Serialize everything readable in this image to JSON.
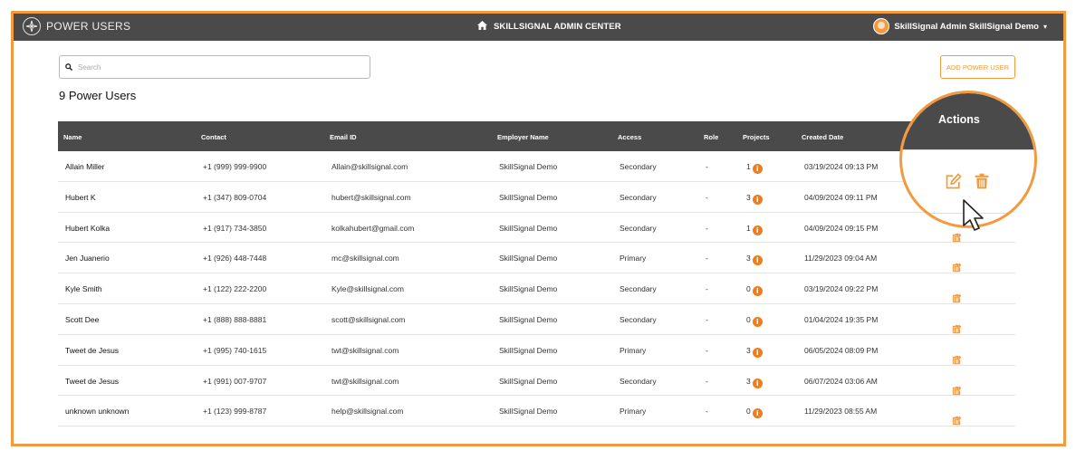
{
  "header": {
    "brand": "POWER USERS",
    "center_title": "SKILLSIGNAL ADMIN CENTER",
    "user_name": "SkillSignal Admin SkillSignal Demo"
  },
  "toolbar": {
    "search_placeholder": "Search",
    "add_button": "ADD POWER USER",
    "count_title": "9 Power Users"
  },
  "table": {
    "columns": {
      "name": "Name",
      "contact": "Contact",
      "email": "Email ID",
      "employer": "Employer Name",
      "access": "Access",
      "role": "Role",
      "projects": "Projects",
      "created": "Created Date",
      "actions": "Actions"
    },
    "rows": [
      {
        "name": "Allain Miller",
        "contact": "+1 (999) 999-9900",
        "email": "Allain@skillsignal.com",
        "employer": "SkillSignal Demo",
        "access": "Secondary",
        "role": "-",
        "projects": "1",
        "created": "03/19/2024 09:13 PM"
      },
      {
        "name": "Hubert K",
        "contact": "+1 (347) 809-0704",
        "email": "hubert@skillsignal.com",
        "employer": "SkillSignal Demo",
        "access": "Secondary",
        "role": "-",
        "projects": "3",
        "created": "04/09/2024 09:11 PM"
      },
      {
        "name": "Hubert Kolka",
        "contact": "+1 (917) 734-3850",
        "email": "kolkahubert@gmail.com",
        "employer": "SkillSignal Demo",
        "access": "Secondary",
        "role": "-",
        "projects": "1",
        "created": "04/09/2024 09:15 PM"
      },
      {
        "name": "Jen Juanerio",
        "contact": "+1 (926) 448-7448",
        "email": "mc@skillsignal.com",
        "employer": "SkillSignal Demo",
        "access": "Primary",
        "role": "-",
        "projects": "3",
        "created": "11/29/2023 09:04 AM"
      },
      {
        "name": "Kyle Smith",
        "contact": "+1 (122) 222-2200",
        "email": "Kyle@skillsignal.com",
        "employer": "SkillSignal Demo",
        "access": "Secondary",
        "role": "-",
        "projects": "0",
        "created": "03/19/2024 09:22 PM"
      },
      {
        "name": "Scott Dee",
        "contact": "+1 (888) 888-8881",
        "email": "scott@skillsignal.com",
        "employer": "SkillSignal Demo",
        "access": "Secondary",
        "role": "-",
        "projects": "0",
        "created": "01/04/2024 19:35 PM"
      },
      {
        "name": "Tweet de Jesus",
        "contact": "+1 (995) 740-1615",
        "email": "twt@skillsignal.com",
        "employer": "SkillSignal Demo",
        "access": "Primary",
        "role": "-",
        "projects": "3",
        "created": "06/05/2024 08:09 PM"
      },
      {
        "name": "Tweet de Jesus",
        "contact": "+1 (991) 007-9707",
        "email": "twt@skillsignal.com",
        "employer": "SkillSignal Demo",
        "access": "Secondary",
        "role": "-",
        "projects": "3",
        "created": "06/07/2024 03:06 AM"
      },
      {
        "name": "unknown unknown",
        "contact": "+1 (123) 999-8787",
        "email": "help@skillsignal.com",
        "employer": "SkillSignal Demo",
        "access": "Primary",
        "role": "-",
        "projects": "0",
        "created": "11/29/2023 08:55 AM"
      }
    ]
  },
  "icons": {
    "brand": "compass-logo-icon",
    "home": "home-icon",
    "search": "search-icon",
    "info": "info-icon",
    "edit": "edit-icon",
    "delete": "trash-icon",
    "cursor": "mouse-pointer-icon",
    "dropdown": "caret-down-icon"
  },
  "colors": {
    "accent": "#f39a3f",
    "header_bg": "#4a4a4a",
    "info_badge": "#f07c1a"
  }
}
